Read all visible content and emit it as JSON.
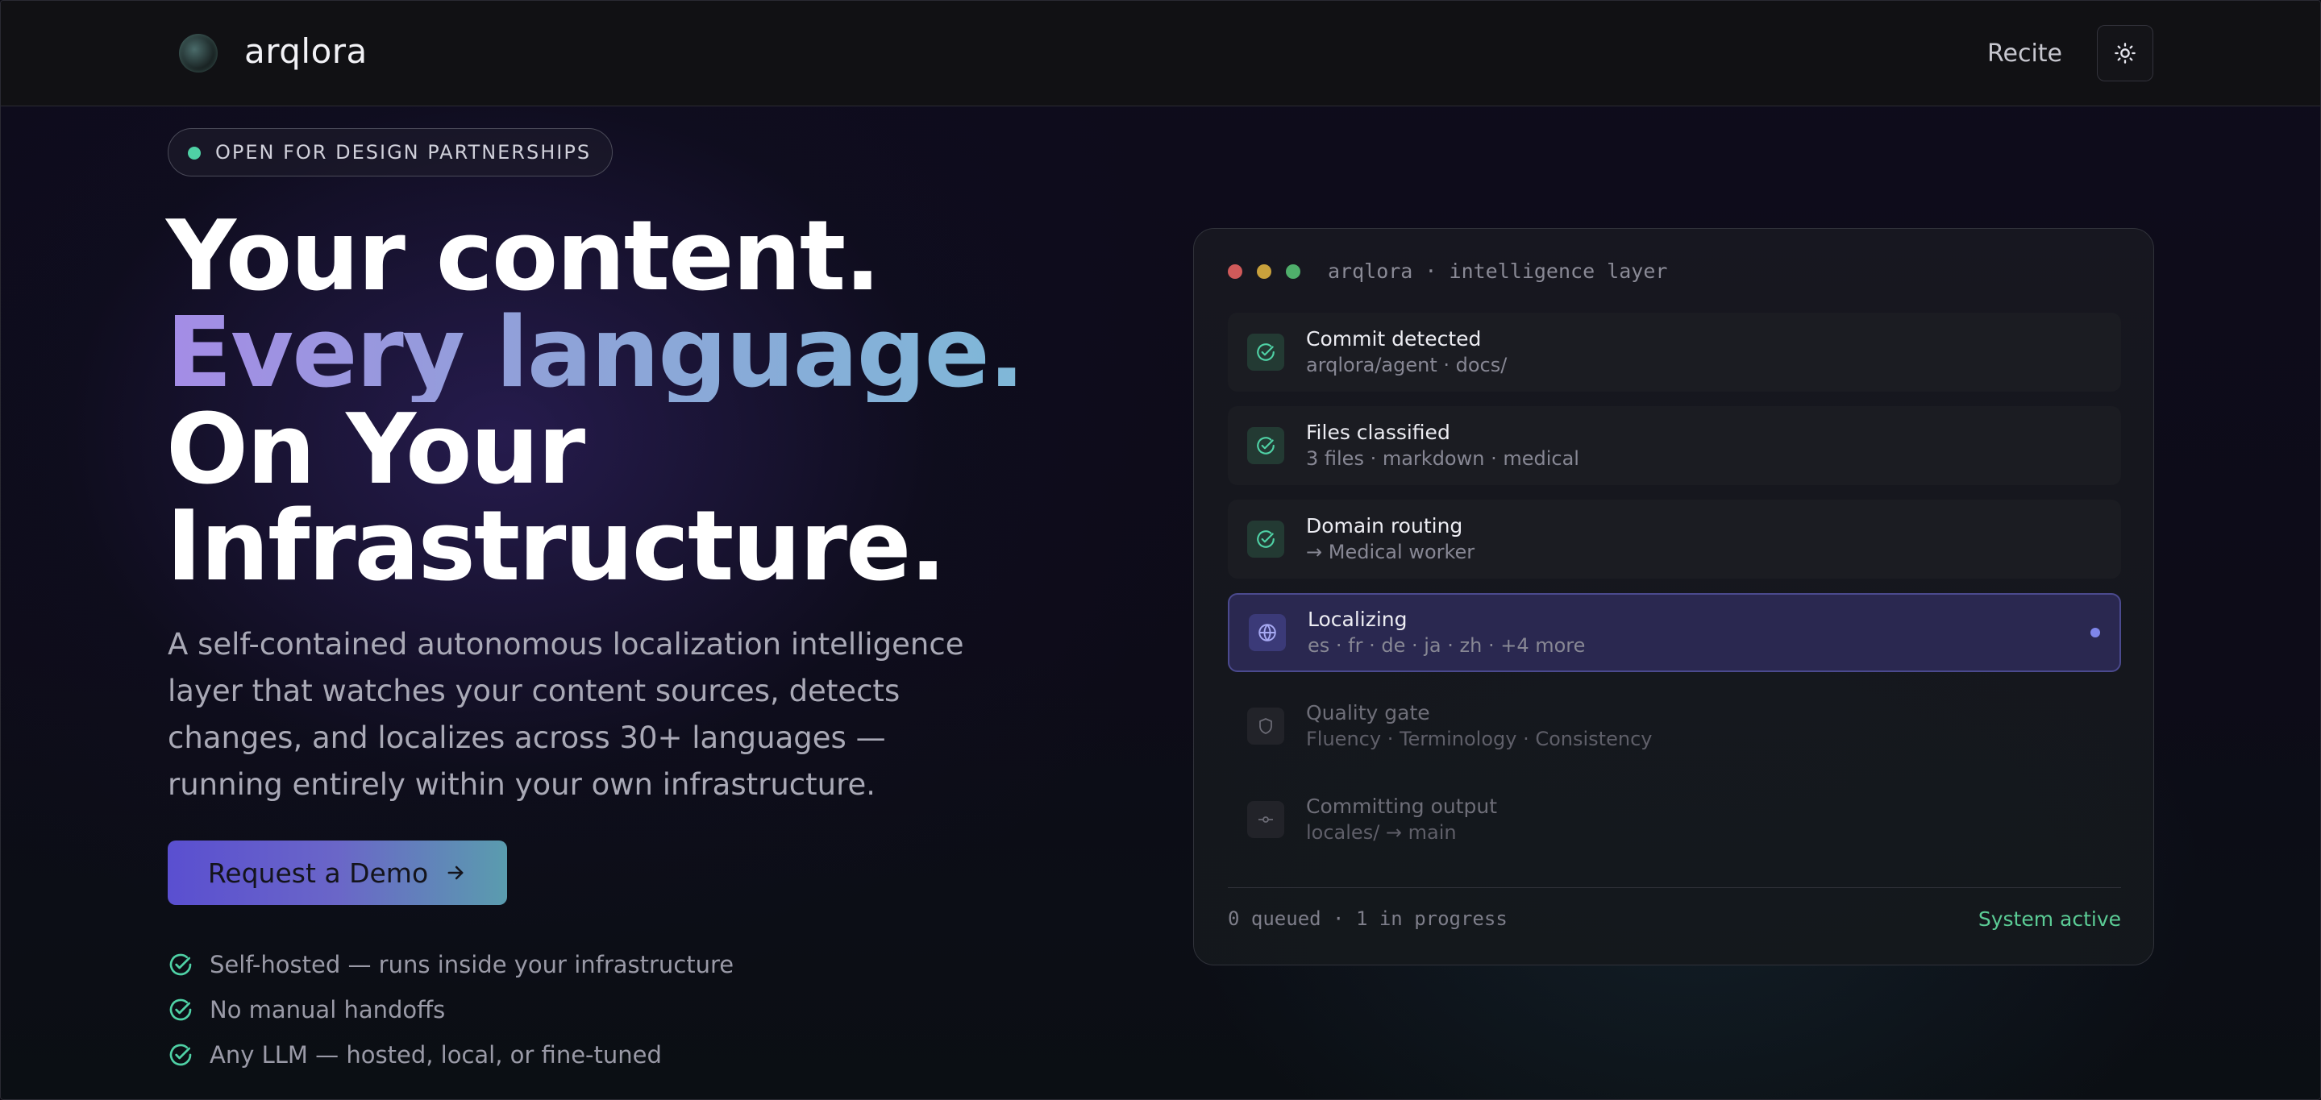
{
  "header": {
    "brand": "arqlora",
    "nav_link": "Recite",
    "theme_icon": "sun-icon"
  },
  "hero": {
    "badge": "OPEN FOR DESIGN PARTNERSHIPS",
    "headline": {
      "line1": "Your content.",
      "line2": "Every language.",
      "line3": "On Your",
      "line4": "Infrastructure."
    },
    "subtext": "A self-contained autonomous localization intelligence layer that watches your content sources, detects changes, and localizes across 30+ languages — running entirely within your own infrastructure.",
    "cta": "Request a Demo",
    "features": [
      "Self-hosted — runs inside your infrastructure",
      "No manual handoffs",
      "Any LLM — hosted, local, or fine-tuned"
    ]
  },
  "panel": {
    "title": "arqlora · intelligence layer",
    "window_dots": [
      "#d05a5a",
      "#c9a13c",
      "#4fae6b"
    ],
    "steps": [
      {
        "title": "Commit detected",
        "detail": "arqlora/agent · docs/",
        "state": "done",
        "icon": "check-circle-icon"
      },
      {
        "title": "Files classified",
        "detail": "3 files · markdown · medical",
        "state": "done",
        "icon": "check-circle-icon"
      },
      {
        "title": "Domain routing",
        "detail": "→ Medical worker",
        "state": "done",
        "icon": "check-circle-icon"
      },
      {
        "title": "Localizing",
        "detail": "es · fr · de · ja · zh · +4 more",
        "state": "active",
        "icon": "globe-icon"
      },
      {
        "title": "Quality gate",
        "detail": "Fluency · Terminology · Consistency",
        "state": "pending",
        "icon": "shield-icon"
      },
      {
        "title": "Committing output",
        "detail": "locales/ → main",
        "state": "pending",
        "icon": "commit-icon"
      }
    ],
    "footer_status": "0 queued · 1 in progress",
    "system_status": "System active"
  },
  "colors": {
    "accent_green": "#4fd1a5",
    "accent_purple": "#7f86ea",
    "status_green": "#5bcc95"
  }
}
